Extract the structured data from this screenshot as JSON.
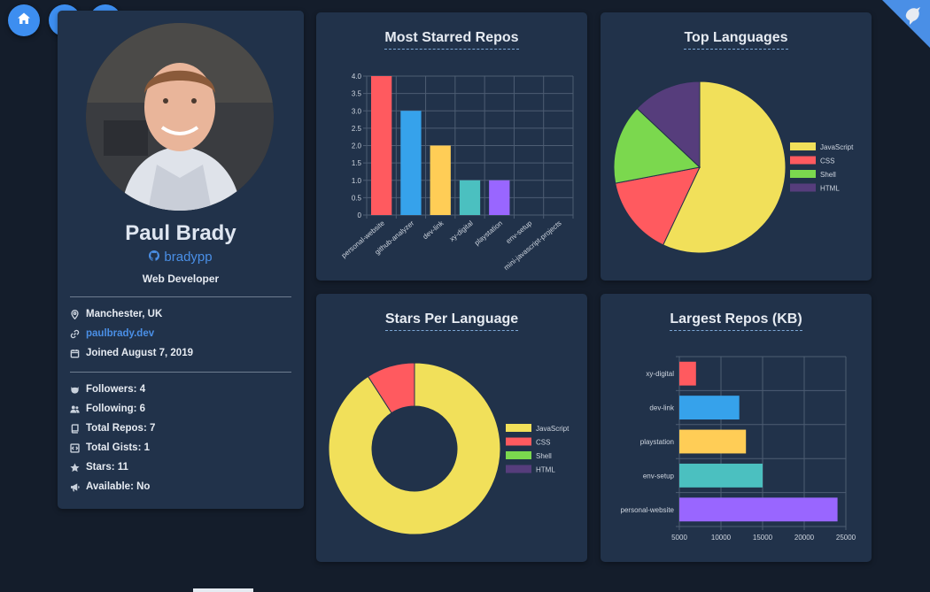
{
  "profile": {
    "name": "Paul Brady",
    "username": "bradypp",
    "role": "Web Developer",
    "location": "Manchester, UK",
    "website": "paulbrady.dev",
    "joined": "Joined August 7, 2019",
    "stats": {
      "followers": "Followers: 4",
      "following": "Following: 6",
      "repos": "Total Repos: 7",
      "gists": "Total Gists: 1",
      "stars": "Stars: 11",
      "available": "Available: No"
    }
  },
  "nav": {
    "icons": [
      "home-icon",
      "shuffle-icon",
      "search-icon"
    ],
    "corner_icon": "bird-icon"
  },
  "colors": {
    "red": "#ff5a5f",
    "blue": "#36a2eb",
    "yellow": "#ffcd56",
    "teal": "#4bc0c0",
    "purple": "#9966ff",
    "js": "#f1e05a",
    "css": "#ff5a5f",
    "shell": "#7bd84e",
    "html": "#563d7c"
  },
  "chart_data": [
    {
      "type": "bar",
      "title": "Most Starred Repos",
      "categories": [
        "personal-website",
        "github-analyzer",
        "dev-link",
        "xy-digital",
        "playstation",
        "env-setup",
        "mini-javascript-projects"
      ],
      "values": [
        4,
        3,
        2,
        1,
        1,
        0,
        0
      ],
      "ylim": [
        0,
        4
      ],
      "yticks": [
        "0",
        "0.5",
        "1.0",
        "1.5",
        "2.0",
        "2.5",
        "3.0",
        "3.5",
        "4.0"
      ],
      "grid": true
    },
    {
      "type": "pie",
      "title": "Top Languages",
      "labels": [
        "JavaScript",
        "CSS",
        "Shell",
        "HTML"
      ],
      "values": [
        57,
        15,
        15,
        13
      ],
      "legend": "right"
    },
    {
      "type": "pie",
      "title": "Stars Per Language",
      "labels": [
        "JavaScript",
        "CSS",
        "Shell",
        "HTML"
      ],
      "values": [
        10,
        1,
        0,
        0
      ],
      "donut": true,
      "legend": "right"
    },
    {
      "type": "bar",
      "orientation": "horizontal",
      "title": "Largest Repos (KB)",
      "categories": [
        "xy-digital",
        "dev-link",
        "playstation",
        "env-setup",
        "personal-website"
      ],
      "values": [
        7000,
        12200,
        13000,
        15000,
        24000
      ],
      "xlim": [
        5000,
        25000
      ],
      "xticks": [
        "5000",
        "10000",
        "15000",
        "20000",
        "25000"
      ],
      "grid": true
    }
  ]
}
